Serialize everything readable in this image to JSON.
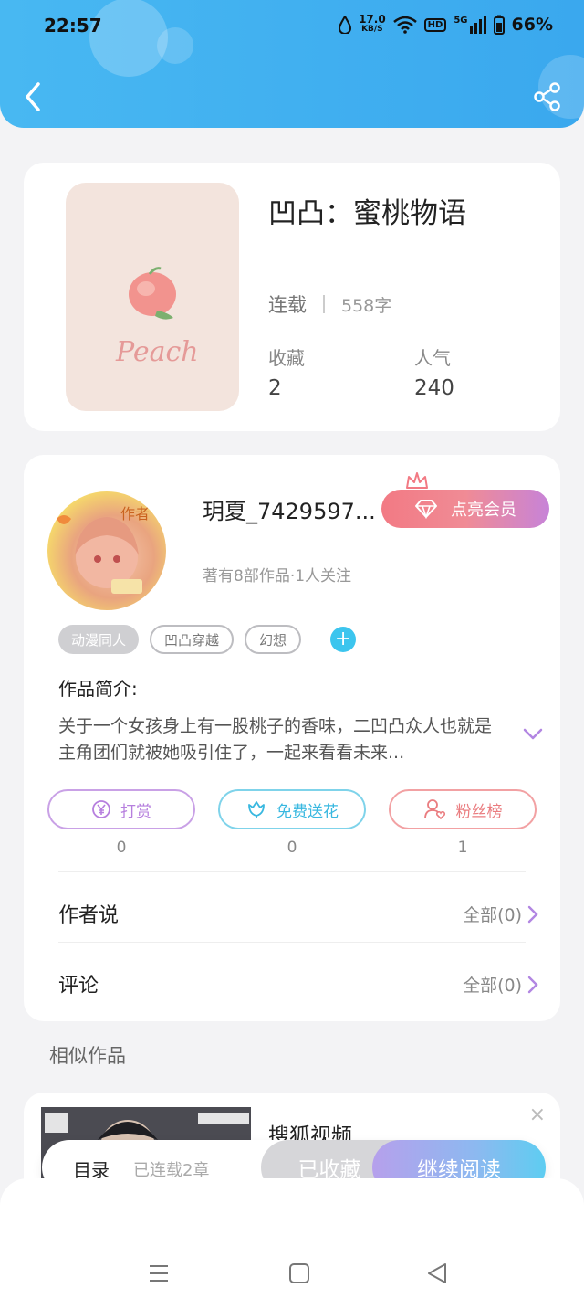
{
  "status_bar": {
    "time": "22:57",
    "speed": "17.0",
    "speed_unit": "KB/S",
    "hd": "HD",
    "net": "5G",
    "battery": "66%"
  },
  "book": {
    "title": "凹凸：蜜桃物语",
    "status": "连载",
    "words": "558字",
    "cover_text": "Peach",
    "favorites_label": "收藏",
    "favorites_value": "2",
    "popularity_label": "人气",
    "popularity_value": "240"
  },
  "author": {
    "name": "玥夏_7429597...",
    "badge": "作者",
    "vip_label": "点亮会员",
    "meta": "著有8部作品·1人关注"
  },
  "tags": [
    "动漫同人",
    "凹凸穿越",
    "幻想"
  ],
  "intro": {
    "label": "作品简介:",
    "text": "关于一个女孩身上有一股桃子的香味，二凹凸众人也就是主角团们就被她吸引住了，一起来看看未来..."
  },
  "actions": [
    {
      "label": "打赏",
      "count": "0"
    },
    {
      "label": "免费送花",
      "count": "0"
    },
    {
      "label": "粉丝榜",
      "count": "1"
    }
  ],
  "rows": [
    {
      "label": "作者说",
      "value": "全部(0)"
    },
    {
      "label": "评论",
      "value": "全部(0)"
    }
  ],
  "similar": {
    "title": "相似作品",
    "ad_title": "搜狐视频"
  },
  "bottom_bar": {
    "toc": "目录",
    "chapters": "已连载2章",
    "saved": "已收藏",
    "read": "继续阅读"
  },
  "colors": {
    "header": "#3aa8ee",
    "vip": "#f27a84",
    "accent": "#3cc5ee"
  }
}
